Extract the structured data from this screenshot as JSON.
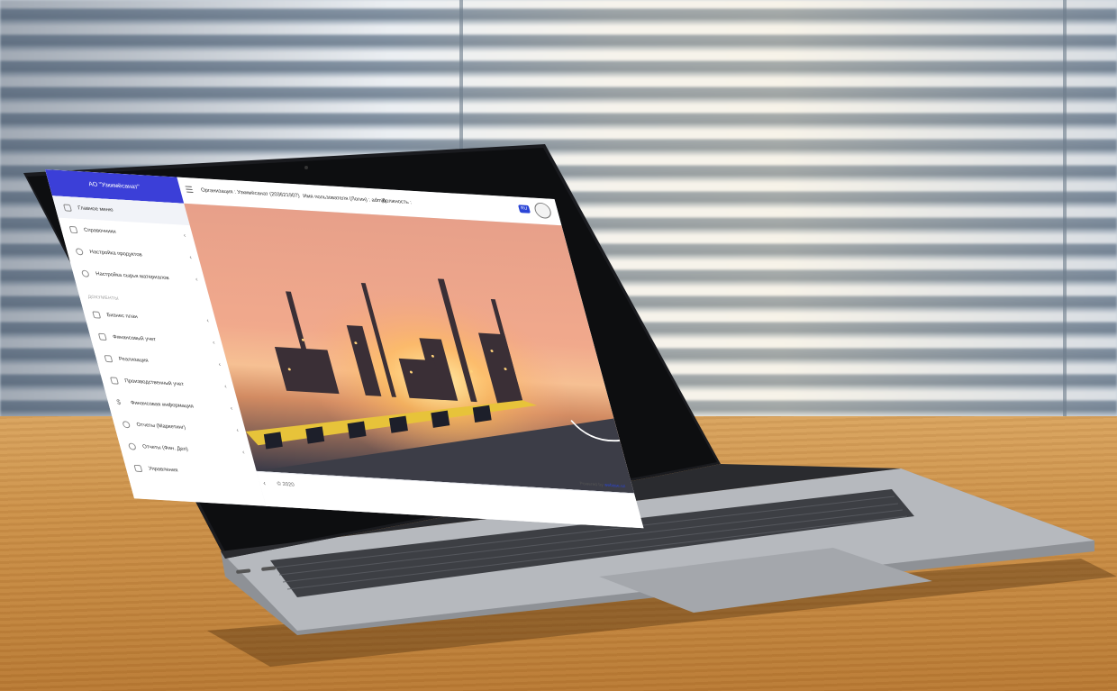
{
  "app": {
    "brand": "АО \"Узкимёсанат\"",
    "organization": "Организация : Узкимёсанат (203621907)",
    "username": "Имя пользователя (Логин) : admin",
    "position": "Должность :",
    "flag_text": "RU"
  },
  "sidebar": {
    "items": [
      {
        "label": "Главное меню",
        "icon": "home-icon"
      },
      {
        "label": "Справочники",
        "icon": "book-icon"
      },
      {
        "label": "Настройка продуктов",
        "icon": "gear-icon"
      },
      {
        "label": "Настройка сырья материалов",
        "icon": "gear-icon"
      }
    ],
    "section_label": "ДОКУМЕНТЫ",
    "doc_items": [
      {
        "label": "Бизнес план",
        "icon": "document-icon"
      },
      {
        "label": "Финансовый учет",
        "icon": "document-icon"
      },
      {
        "label": "Реализация",
        "icon": "document-icon"
      },
      {
        "label": "Производственный учет",
        "icon": "document-icon"
      },
      {
        "label": "Финансовая информация",
        "icon": "dollar-icon"
      },
      {
        "label": "Отчеты (Маркетинг)",
        "icon": "chart-icon"
      },
      {
        "label": "Отчеты (Фин. Деп)",
        "icon": "chart-icon"
      },
      {
        "label": "Управления",
        "icon": "settings-icon"
      }
    ]
  },
  "footer": {
    "copyright": "© 2020",
    "powered_prefix": "Powered by",
    "powered_link": "webase.uz"
  },
  "colors": {
    "brand": "#3b3fd8",
    "link": "#2b45d6"
  }
}
